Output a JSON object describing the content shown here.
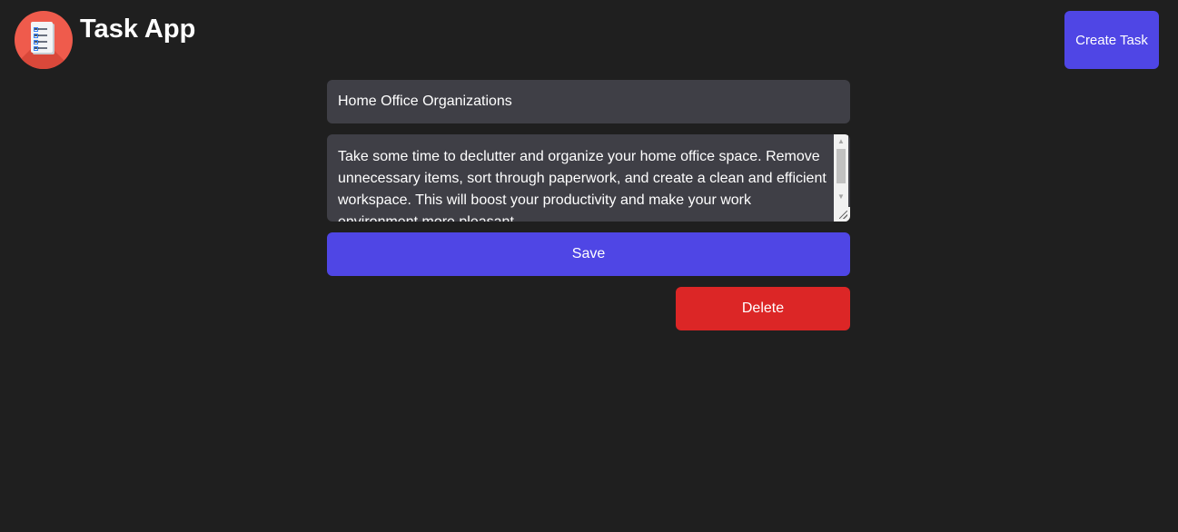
{
  "header": {
    "app_title": "Task App",
    "logo_icon": "task-list-icon",
    "create_button_label": "Create Task"
  },
  "task": {
    "title_value": "Home Office Organizations",
    "description_value": "Take some time to declutter and organize your home office space. Remove unnecessary items, sort through paperwork, and create a clean and efficient workspace. This will boost your productivity and make your work environment more pleasant."
  },
  "actions": {
    "save_label": "Save",
    "delete_label": "Delete"
  },
  "colors": {
    "background": "#1f1f1f",
    "field": "#3f3f46",
    "primary": "#4f46e5",
    "danger": "#dc2626",
    "logo": "#ef5b4c"
  }
}
